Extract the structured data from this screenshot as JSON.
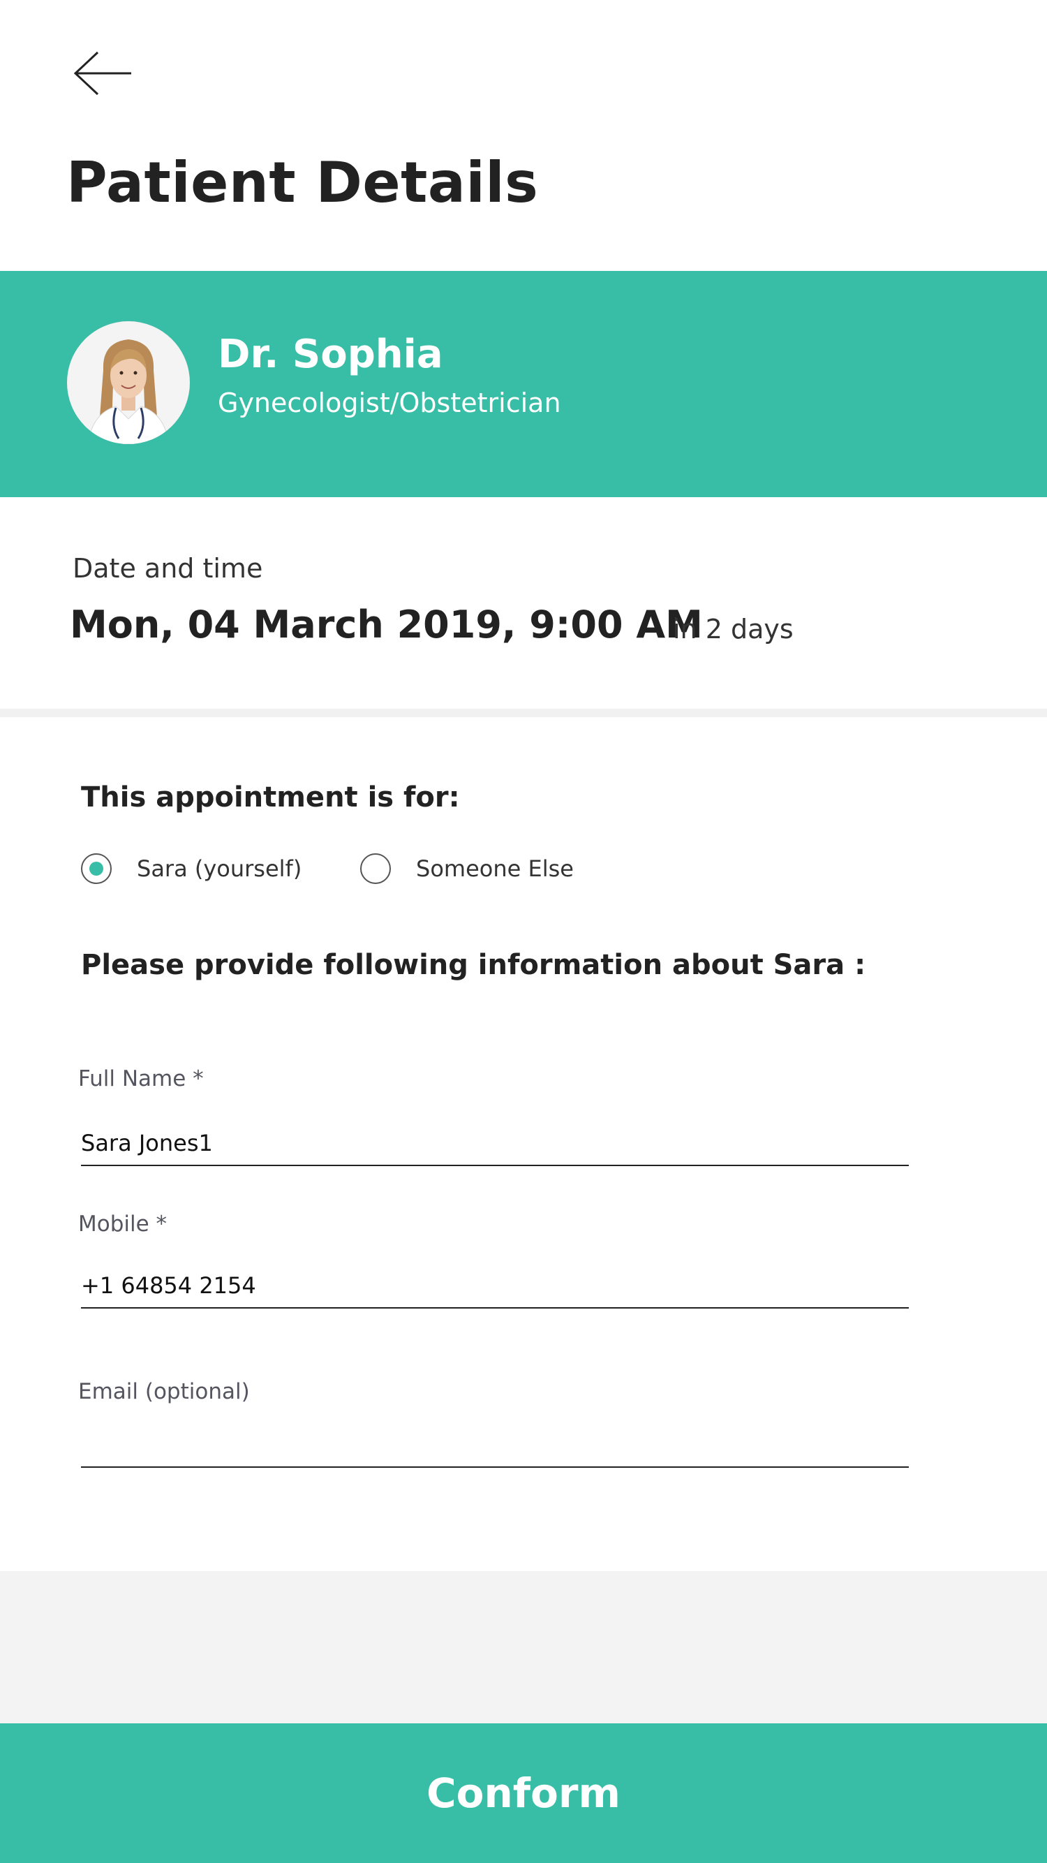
{
  "header": {
    "back_icon": "arrow-left-icon",
    "title": "Patient Details"
  },
  "doctor": {
    "avatar_icon": "doctor-avatar",
    "name": "Dr. Sophia",
    "specialty": "Gynecologist/Obstetrician"
  },
  "appointment": {
    "label": "Date and time",
    "datetime": "Mon, 04 March 2019, 9:00 AM",
    "relative": "in 2 days"
  },
  "patient_choice": {
    "heading": "This appointment is for:",
    "options": [
      {
        "label": "Sara (yourself)",
        "selected": true
      },
      {
        "label": "Someone Else",
        "selected": false
      }
    ]
  },
  "form": {
    "heading": "Please provide following information about Sara :",
    "full_name": {
      "label": "Full Name *",
      "value": "Sara Jones1"
    },
    "mobile": {
      "label": "Mobile *",
      "value": "+1 64854 2154"
    },
    "email": {
      "label": "Email (optional)",
      "value": ""
    }
  },
  "footer": {
    "confirm_label": "Conform"
  },
  "colors": {
    "accent": "#38bea7",
    "text": "#222222",
    "footer_bg": "#f3f3f3"
  }
}
